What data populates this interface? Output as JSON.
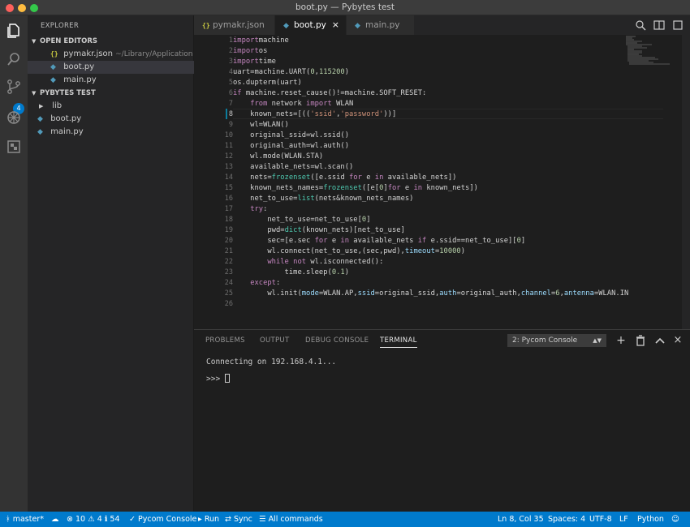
{
  "window": {
    "title": "boot.py — Pybytes test"
  },
  "activity_bar": {
    "scm_badge": "4"
  },
  "sidebar": {
    "title": "EXPLORER",
    "open_editors": {
      "header": "OPEN EDITORS",
      "items": [
        {
          "icon": "{}",
          "label": "pymakr.json",
          "path": "~/Library/Application Su..."
        },
        {
          "icon": "py",
          "label": "boot.py"
        },
        {
          "icon": "py",
          "label": "main.py"
        }
      ]
    },
    "project": {
      "header": "PYBYTES TEST",
      "items": [
        {
          "label": "lib"
        },
        {
          "label": "boot.py"
        },
        {
          "label": "main.py"
        }
      ]
    }
  },
  "tabs": [
    {
      "icon": "{}",
      "label": "pymakr.json"
    },
    {
      "icon": "py",
      "label": "boot.py",
      "close": "×"
    },
    {
      "icon": "py",
      "label": "main.py"
    }
  ],
  "editor": {
    "current_line": 8,
    "lines": [
      [
        [
          "kw",
          "import"
        ],
        [
          "",
          "machine"
        ]
      ],
      [
        [
          "kw",
          "import"
        ],
        [
          "",
          "os"
        ]
      ],
      [
        [
          "kw",
          "import"
        ],
        [
          "",
          "time"
        ]
      ],
      [
        [
          "",
          "uart=machine.UART("
        ],
        [
          "num",
          "0"
        ],
        [
          "",
          ","
        ],
        [
          "num",
          "115200"
        ],
        [
          "",
          ")"
        ]
      ],
      [
        [
          "",
          "os.dupterm(uart)"
        ]
      ],
      [
        [
          "kw",
          "if"
        ],
        [
          "",
          " machine.reset_cause()!=machine.SOFT_RESET:"
        ]
      ],
      [
        [
          "",
          "    "
        ],
        [
          "kw",
          "from"
        ],
        [
          "",
          " network "
        ],
        [
          "kw",
          "import"
        ],
        [
          "",
          " WLAN"
        ]
      ],
      [
        [
          "",
          "    known_nets=[(("
        ],
        [
          "str",
          "'ssid'"
        ],
        [
          "",
          ","
        ],
        [
          "str",
          "'password'"
        ],
        [
          "",
          "))]"
        ]
      ],
      [
        [
          "",
          "    wl=WLAN()"
        ]
      ],
      [
        [
          "",
          "    original_ssid=wl.ssid()"
        ]
      ],
      [
        [
          "",
          "    original_auth=wl.auth()"
        ]
      ],
      [
        [
          "",
          "    wl.mode(WLAN.STA)"
        ]
      ],
      [
        [
          "",
          "    available_nets=wl.scan()"
        ]
      ],
      [
        [
          "",
          "    nets="
        ],
        [
          "bi",
          "frozenset"
        ],
        [
          "",
          "([e.ssid "
        ],
        [
          "kw",
          "for"
        ],
        [
          "",
          " e "
        ],
        [
          "kw",
          "in"
        ],
        [
          "",
          " available_nets])"
        ]
      ],
      [
        [
          "",
          "    known_nets_names="
        ],
        [
          "bi",
          "frozenset"
        ],
        [
          "",
          "([e["
        ],
        [
          "num",
          "0"
        ],
        [
          "",
          "]"
        ],
        [
          "kw",
          "for"
        ],
        [
          "",
          " e "
        ],
        [
          "kw",
          "in"
        ],
        [
          "",
          " known_nets])"
        ]
      ],
      [
        [
          "",
          "    net_to_use="
        ],
        [
          "bi",
          "list"
        ],
        [
          "",
          "(nets&known_nets_names)"
        ]
      ],
      [
        [
          "",
          "    "
        ],
        [
          "kw",
          "try"
        ],
        [
          "",
          ":"
        ]
      ],
      [
        [
          "",
          "        net_to_use=net_to_use["
        ],
        [
          "num",
          "0"
        ],
        [
          "",
          "]"
        ]
      ],
      [
        [
          "",
          "        pwd="
        ],
        [
          "bi",
          "dict"
        ],
        [
          "",
          "(known_nets)[net_to_use]"
        ]
      ],
      [
        [
          "",
          "        sec=[e.sec "
        ],
        [
          "kw",
          "for"
        ],
        [
          "",
          " e "
        ],
        [
          "kw",
          "in"
        ],
        [
          "",
          " available_nets "
        ],
        [
          "kw",
          "if"
        ],
        [
          "",
          " e.ssid==net_to_use]["
        ],
        [
          "num",
          "0"
        ],
        [
          "",
          "]"
        ]
      ],
      [
        [
          "",
          "        wl.connect(net_to_use,(sec,pwd),"
        ],
        [
          "prm",
          "timeout"
        ],
        [
          "",
          "="
        ],
        [
          "num",
          "10000"
        ],
        [
          "",
          ")"
        ]
      ],
      [
        [
          "",
          "        "
        ],
        [
          "kw",
          "while"
        ],
        [
          "",
          ""
        ],
        [
          "kw",
          " not"
        ],
        [
          "",
          " wl.isconnected():"
        ]
      ],
      [
        [
          "",
          "            time.sleep("
        ],
        [
          "num",
          "0.1"
        ],
        [
          "",
          ")"
        ]
      ],
      [
        [
          "",
          "    "
        ],
        [
          "kw",
          "except"
        ],
        [
          "",
          ":"
        ]
      ],
      [
        [
          "",
          "        wl.init("
        ],
        [
          "prm",
          "mode"
        ],
        [
          "",
          "=WLAN.AP,"
        ],
        [
          "prm",
          "ssid"
        ],
        [
          "",
          "=original_ssid,"
        ],
        [
          "prm",
          "auth"
        ],
        [
          "",
          "=original_auth,"
        ],
        [
          "prm",
          "channel"
        ],
        [
          "",
          "="
        ],
        [
          "num",
          "6"
        ],
        [
          "",
          ","
        ],
        [
          "prm",
          "antenna"
        ],
        [
          "",
          "=WLAN.IN"
        ]
      ],
      [
        [
          "",
          ""
        ]
      ]
    ]
  },
  "panel": {
    "tabs": [
      "PROBLEMS",
      "OUTPUT",
      "DEBUG CONSOLE",
      "TERMINAL"
    ],
    "active_tab": "TERMINAL",
    "terminal_select": "2: Pycom Console",
    "terminal_lines": [
      "Connecting on 192.168.4.1...",
      ">>> "
    ]
  },
  "statusbar": {
    "branch": "master*",
    "errors": "10",
    "warnings": "4",
    "infos": "54",
    "pycom_console": "Pycom Console",
    "run": "Run",
    "sync": "Sync",
    "all_commands": "All commands",
    "position": "Ln 8, Col 35",
    "spaces": "Spaces: 4",
    "encoding": "UTF-8",
    "eol": "LF",
    "language": "Python"
  },
  "colors": {
    "accent": "#007acc",
    "editor_bg": "#1e1e1e",
    "sidebar_bg": "#252526",
    "keyword": "#c586c0",
    "string": "#ce9178",
    "number": "#b5cea8"
  }
}
